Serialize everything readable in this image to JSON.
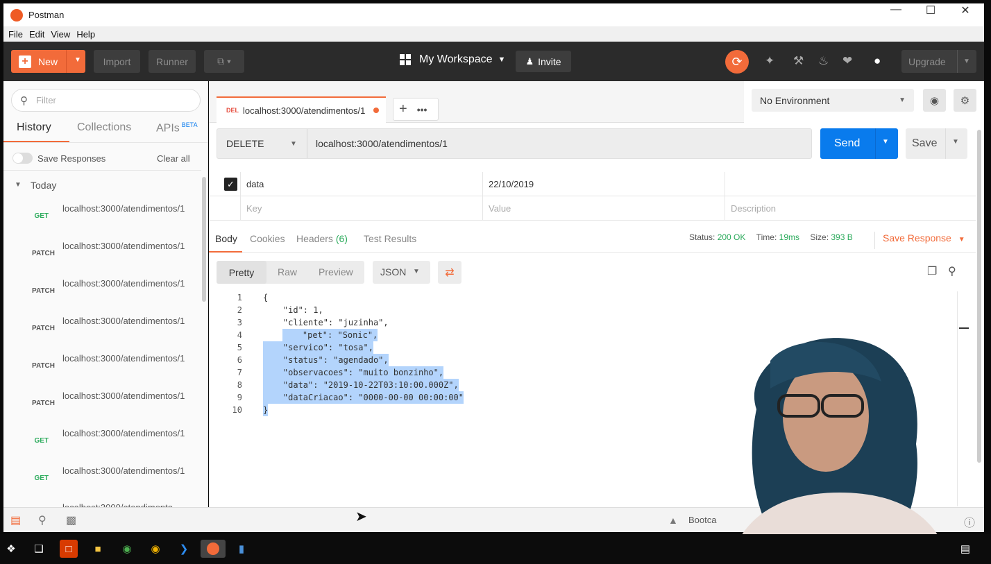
{
  "app": {
    "title": "Postman"
  },
  "menu": [
    "File",
    "Edit",
    "View",
    "Help"
  ],
  "header": {
    "new_label": "New",
    "import_label": "Import",
    "runner_label": "Runner",
    "workspace_label": "My Workspace",
    "invite_label": "Invite",
    "upgrade_label": "Upgrade"
  },
  "sidebar": {
    "filter_placeholder": "Filter",
    "tabs": [
      "History",
      "Collections",
      "APIs"
    ],
    "apis_badge": "BETA",
    "save_responses_label": "Save Responses",
    "clear_all_label": "Clear all",
    "group_label": "Today",
    "items": [
      {
        "method": "GET",
        "url": "localhost:3000/atendimentos/1"
      },
      {
        "method": "PATCH",
        "url": "localhost:3000/atendimentos/1"
      },
      {
        "method": "PATCH",
        "url": "localhost:3000/atendimentos/1"
      },
      {
        "method": "PATCH",
        "url": "localhost:3000/atendimentos/1"
      },
      {
        "method": "PATCH",
        "url": "localhost:3000/atendimentos/1"
      },
      {
        "method": "PATCH",
        "url": "localhost:3000/atendimentos/1"
      },
      {
        "method": "GET",
        "url": "localhost:3000/atendimentos/1"
      },
      {
        "method": "GET",
        "url": "localhost:3000/atendimentos/1"
      },
      {
        "method": "",
        "url": "localhost:3000/atendimento"
      }
    ]
  },
  "request_tab": {
    "method": "DEL",
    "url": "localhost:3000/atendimentos/1"
  },
  "environment": {
    "selected": "No Environment"
  },
  "request": {
    "method": "DELETE",
    "url": "localhost:3000/atendimentos/1",
    "send_label": "Send",
    "save_label": "Save"
  },
  "params": {
    "row": {
      "key": "data",
      "value": "22/10/2019"
    },
    "placeholder": {
      "key": "Key",
      "value": "Value",
      "description": "Description"
    }
  },
  "response": {
    "tabs": {
      "body": "Body",
      "cookies": "Cookies",
      "headers": "Headers",
      "headers_count": "(6)",
      "tests": "Test Results"
    },
    "status_label": "Status:",
    "status_value": "200 OK",
    "time_label": "Time:",
    "time_value": "19ms",
    "size_label": "Size:",
    "size_value": "393 B",
    "save_response_label": "Save Response",
    "format_tabs": [
      "Pretty",
      "Raw",
      "Preview"
    ],
    "format_type": "JSON",
    "code_lines": [
      "{",
      "    \"id\": 1,",
      "    \"cliente\": \"juzinha\",",
      "    \"pet\": \"Sonic\",",
      "    \"servico\": \"tosa\",",
      "    \"status\": \"agendado\",",
      "    \"observacoes\": \"muito bonzinho\",",
      "    \"data\": \"2019-10-22T03:10:00.000Z\",",
      "    \"dataCriacao\": \"0000-00-00 00:00:00\"",
      "}"
    ]
  },
  "statusbar": {
    "bootcamp_label": "Bootca"
  },
  "colors": {
    "accent": "#f26b3a",
    "send": "#097bed",
    "get": "#2cab5c",
    "patch": "#555555",
    "status_ok": "#2cab5c"
  }
}
